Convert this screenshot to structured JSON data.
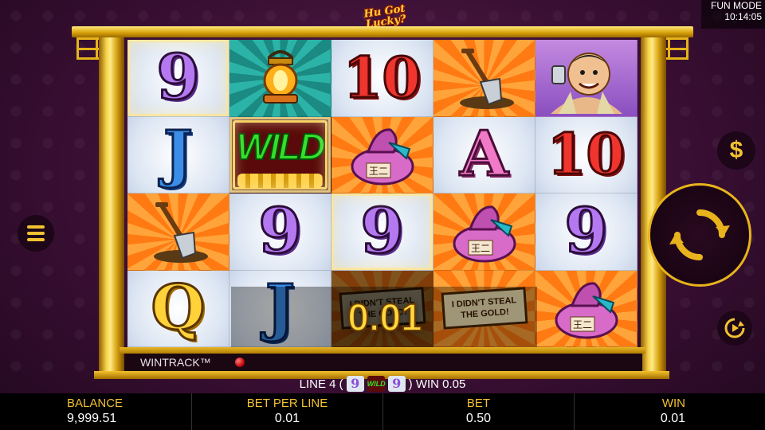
{
  "logo": {
    "text": "Hu Got Lucky?"
  },
  "status": {
    "mode": "FUN MODE",
    "time": "10:14:05"
  },
  "reels": [
    [
      {
        "symbol": "9",
        "style": "purple",
        "bg": "light",
        "highlight": true
      },
      {
        "symbol": "lantern",
        "style": "icon",
        "bg": "teal"
      },
      {
        "symbol": "10",
        "style": "red",
        "bg": "light"
      },
      {
        "symbol": "shovel",
        "style": "icon",
        "bg": "orange"
      },
      {
        "symbol": "hu-character",
        "style": "icon",
        "bg": "purple"
      }
    ],
    [
      {
        "symbol": "J",
        "style": "blue",
        "bg": "light"
      },
      {
        "symbol": "WILD",
        "style": "wild",
        "bg": "dark",
        "highlight": true
      },
      {
        "symbol": "money-bag",
        "style": "icon",
        "bg": "orange"
      },
      {
        "symbol": "A",
        "style": "pink",
        "bg": "light"
      },
      {
        "symbol": "10",
        "style": "red",
        "bg": "light"
      }
    ],
    [
      {
        "symbol": "shovel",
        "style": "icon",
        "bg": "orange"
      },
      {
        "symbol": "9",
        "style": "purple",
        "bg": "light"
      },
      {
        "symbol": "9",
        "style": "purple",
        "bg": "light",
        "highlight": true
      },
      {
        "symbol": "money-bag",
        "style": "icon",
        "bg": "orange"
      },
      {
        "symbol": "9",
        "style": "purple",
        "bg": "light"
      }
    ],
    [
      {
        "symbol": "Q",
        "style": "gold",
        "bg": "light"
      },
      {
        "symbol": "J",
        "style": "blue",
        "bg": "light"
      },
      {
        "symbol": "sign",
        "style": "icon",
        "bg": "orange",
        "dim": true
      },
      {
        "symbol": "sign",
        "style": "icon",
        "bg": "orange"
      },
      {
        "symbol": "money-bag",
        "style": "icon",
        "bg": "orange"
      }
    ]
  ],
  "sign_text": "I DIDN'T STEAL THE GOLD!",
  "bag_text": "王二",
  "win_amount": "0.01",
  "wintrack": {
    "label": "WINTRACK™"
  },
  "line_win": {
    "prefix": "LINE 4 (",
    "symbol_a": "9",
    "symbol_b": "WILD",
    "symbol_c": "9",
    "suffix": ") WIN 0.05"
  },
  "bottom_bar": {
    "balance_label": "BALANCE",
    "balance_value": "9,999.51",
    "bet_per_line_label": "BET PER LINE",
    "bet_per_line_value": "0.01",
    "bet_label": "BET",
    "bet_value": "0.50",
    "win_label": "WIN",
    "win_value": "0.01"
  },
  "buttons": {
    "menu_icon": "menu-icon",
    "coin_icon": "dollar-icon",
    "coin_symbol": "$",
    "spin_icon": "spin-icon",
    "autoplay_icon": "autoplay-icon"
  },
  "colors": {
    "gold": "#f2c230",
    "wild_green": "#33e02a",
    "background": "#3a0f34"
  }
}
